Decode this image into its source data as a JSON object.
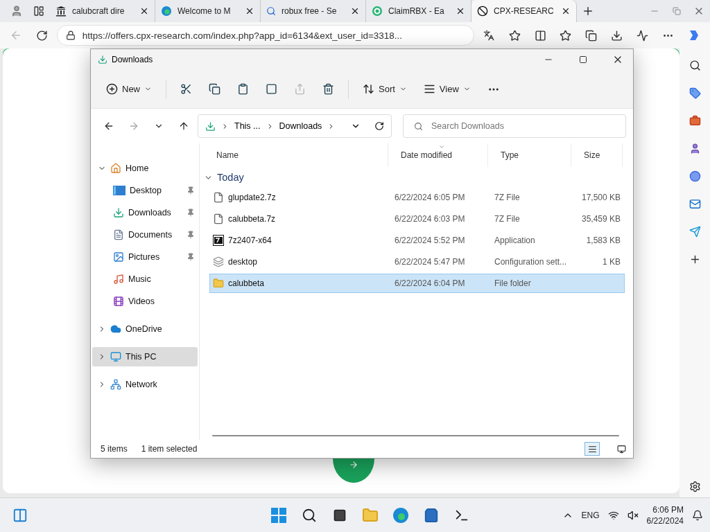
{
  "browser": {
    "tabs": [
      {
        "title": "calubcraft dire",
        "selected": false
      },
      {
        "title": "Welcome to M",
        "selected": false
      },
      {
        "title": "robux free - Se",
        "selected": false
      },
      {
        "title": "ClaimRBX - Ea",
        "selected": false
      },
      {
        "title": "CPX-RESEARC",
        "selected": true
      }
    ],
    "url": "https://offers.cpx-research.com/index.php?app_id=6134&ext_user_id=3318..."
  },
  "explorer": {
    "title": "Downloads",
    "toolbar": {
      "new": "New",
      "sort": "Sort",
      "view": "View"
    },
    "breadcrumb": [
      "This ...",
      "Downloads"
    ],
    "search": {
      "placeholder": "Search Downloads"
    },
    "nav": [
      {
        "label": "Home",
        "expanded": true,
        "selected": false,
        "children": [
          {
            "label": "Desktop",
            "pinned": true,
            "kind": "desktop"
          },
          {
            "label": "Downloads",
            "pinned": true,
            "kind": "downloads"
          },
          {
            "label": "Documents",
            "pinned": true,
            "kind": "documents"
          },
          {
            "label": "Pictures",
            "pinned": true,
            "kind": "pictures"
          },
          {
            "label": "Music",
            "pinned": false,
            "kind": "music"
          },
          {
            "label": "Videos",
            "pinned": false,
            "kind": "videos"
          }
        ]
      },
      {
        "label": "OneDrive",
        "expanded": false,
        "selected": false,
        "kind": "cloud"
      },
      {
        "label": "This PC",
        "expanded": false,
        "selected": true,
        "kind": "pc"
      },
      {
        "label": "Network",
        "expanded": false,
        "selected": false,
        "kind": "network"
      }
    ],
    "columns": [
      {
        "label": "Name",
        "sorted": false
      },
      {
        "label": "Date modified",
        "sorted": true
      },
      {
        "label": "Type",
        "sorted": false
      },
      {
        "label": "Size",
        "sorted": false
      }
    ],
    "group": {
      "label": "Today",
      "expanded": true
    },
    "files": [
      {
        "name": "glupdate2.7z",
        "date": "6/22/2024 6:05 PM",
        "type": "7Z File",
        "size": "17,500 KB",
        "kind": "archive",
        "selected": false
      },
      {
        "name": "calubbeta.7z",
        "date": "6/22/2024 6:03 PM",
        "type": "7Z File",
        "size": "35,459 KB",
        "kind": "archive",
        "selected": false
      },
      {
        "name": "7z2407-x64",
        "date": "6/22/2024 5:52 PM",
        "type": "Application",
        "size": "1,583 KB",
        "kind": "app",
        "selected": false
      },
      {
        "name": "desktop",
        "date": "6/22/2024 5:47 PM",
        "type": "Configuration sett...",
        "size": "1 KB",
        "kind": "config",
        "selected": false
      },
      {
        "name": "calubbeta",
        "date": "6/22/2024 6:04 PM",
        "type": "File folder",
        "kind": "folder",
        "selected": true
      }
    ],
    "status": {
      "count": "5 items",
      "selection": "1 item selected"
    },
    "view_modes": [
      {
        "kind": "details",
        "selected": true
      },
      {
        "kind": "tiles",
        "selected": false
      }
    ]
  },
  "taskbar": {
    "language": "ENG",
    "time": "6:06 PM",
    "date": "6/22/2024"
  }
}
